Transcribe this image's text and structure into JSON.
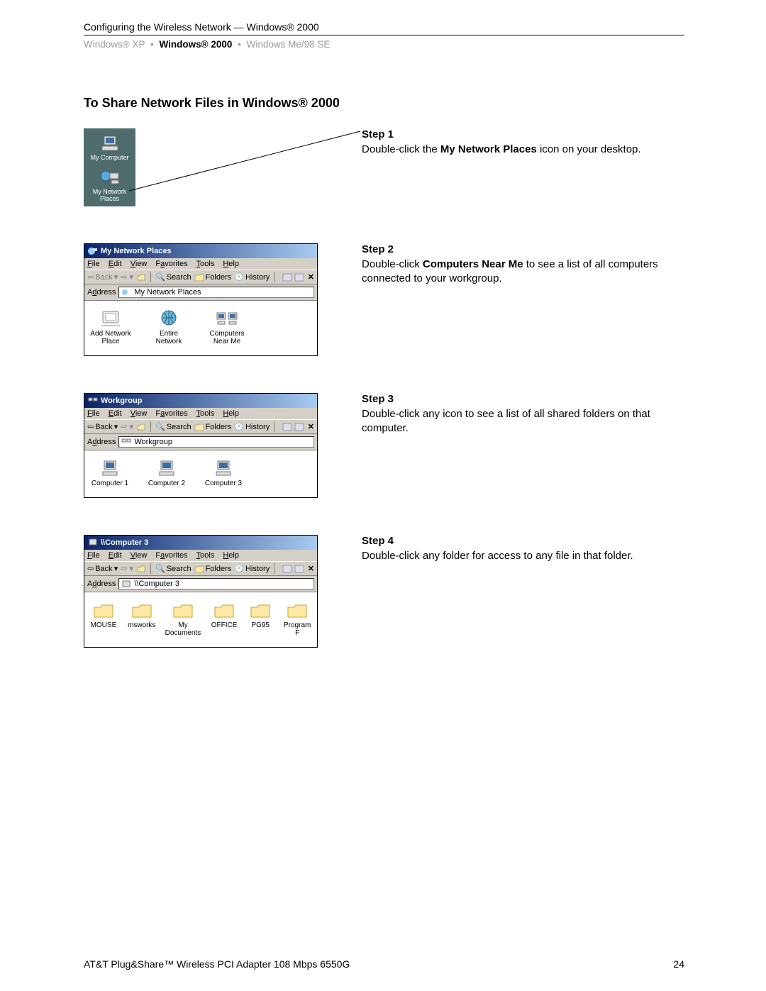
{
  "header": {
    "title": "Configuring the Wireless Network — Windows® 2000",
    "nav": {
      "xp": "Windows® XP",
      "w2k": "Windows® 2000",
      "me98": "Windows Me/98 SE"
    }
  },
  "section_title": "To Share Network Files in Windows® 2000",
  "step1": {
    "heading": "Step 1",
    "text_a": "Double-click the ",
    "bold": "My Network Places",
    "text_b": " icon on your desktop.",
    "desktop": {
      "mycomp": "My Computer",
      "mynet": "My Network Places"
    }
  },
  "step2": {
    "heading": "Step 2",
    "text_a": "Double-click ",
    "bold": "Computers Near Me",
    "text_b": " to see a list of all computers connected to your workgroup.",
    "win_title": "My Network Places",
    "address": "My Network Places",
    "icons": {
      "addnet": "Add Network Place",
      "entire": "Entire Network",
      "near": "Computers Near Me"
    }
  },
  "step3": {
    "heading": "Step 3",
    "text": "Double-click any icon to see a list of all shared folders on that computer.",
    "win_title": "Workgroup",
    "address": "Workgroup",
    "icons": {
      "c1": "Computer 1",
      "c2": "Computer 2",
      "c3": "Computer 3"
    }
  },
  "step4": {
    "heading": "Step 4",
    "text": "Double-click any folder for access to any file in that folder.",
    "win_title": "\\\\Computer 3",
    "address": "\\\\Computer 3",
    "icons": {
      "f1": "MOUSE",
      "f2": "msworks",
      "f3": "My Documents",
      "f4": "OFFICE",
      "f5": "PG95",
      "f6": "Program F"
    }
  },
  "ui": {
    "menu": {
      "file": "File",
      "edit": "Edit",
      "view": "View",
      "fav": "Favorites",
      "tools": "Tools",
      "help": "Help"
    },
    "toolbar": {
      "back": "Back",
      "search": "Search",
      "folders": "Folders",
      "history": "History"
    },
    "address_label": "Address"
  },
  "footer": {
    "left": "AT&T Plug&Share™ Wireless PCI Adapter 108 Mbps 6550G",
    "right": "24"
  }
}
